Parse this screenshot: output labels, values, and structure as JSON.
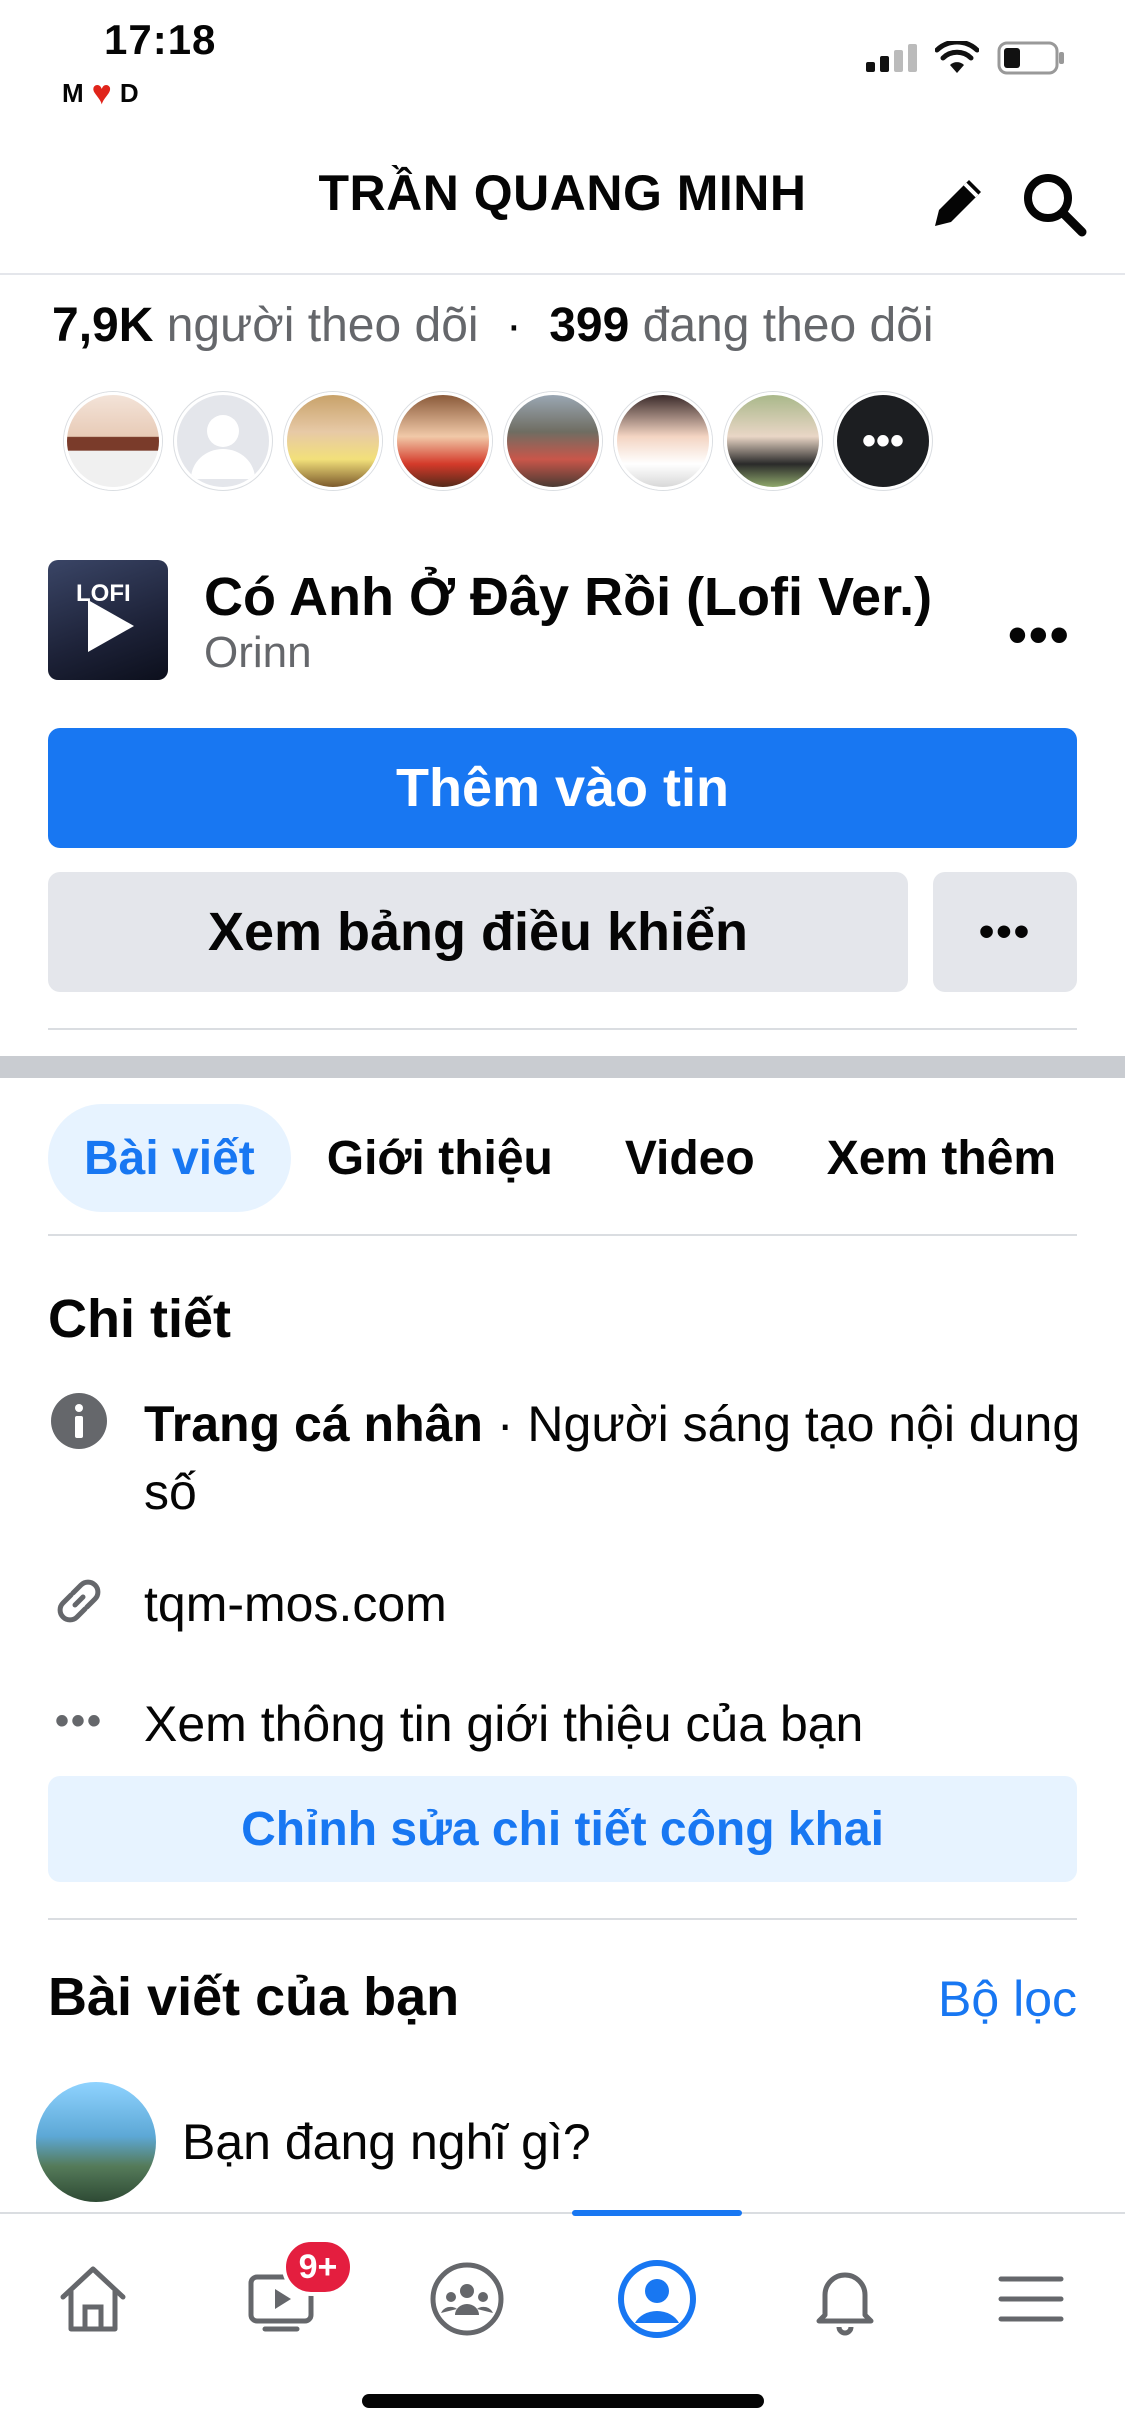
{
  "status_bar": {
    "time": "17:18",
    "carrier_left": "M",
    "carrier_right": "D"
  },
  "header": {
    "title": "TRẦN QUANG MINH"
  },
  "followers": {
    "followers_count": "7,9K",
    "followers_label": "người theo dõi",
    "separator": "·",
    "following_count": "399",
    "following_label": "đang theo dõi",
    "more_avatars": "•••"
  },
  "music": {
    "cover_text": "LOFI",
    "title": "Có Anh Ở Đây Rồi (Lofi Ver.)",
    "artist": "Orinn",
    "more": "•••"
  },
  "actions": {
    "add_to_story": "Thêm vào tin",
    "view_dashboard": "Xem bảng điều khiển",
    "more": "•••"
  },
  "tabs": [
    {
      "label": "Bài viết",
      "active": true
    },
    {
      "label": "Giới thiệu",
      "active": false
    },
    {
      "label": "Video",
      "active": false
    },
    {
      "label": "Xem thêm",
      "active": false
    }
  ],
  "details": {
    "title": "Chi tiết",
    "profile_type_bold": "Trang cá nhân",
    "profile_type_rest": " · Người sáng tạo nội dung số",
    "website": "tqm-mos.com",
    "see_about": "Xem thông tin giới thiệu của bạn",
    "edit_public_details": "Chỉnh sửa chi tiết công khai"
  },
  "posts": {
    "title": "Bài viết của bạn",
    "filter": "Bộ lọc",
    "composer_placeholder": "Bạn đang nghĩ gì?"
  },
  "bottom_nav": {
    "items": [
      "home-icon",
      "watch-icon",
      "groups-icon",
      "profile-icon",
      "notifications-icon",
      "menu-icon"
    ],
    "watch_badge": "9+",
    "active": "profile-icon"
  },
  "colors": {
    "accent": "#1877f2",
    "accent_light": "#e7f3ff",
    "badge": "#e41e3f",
    "button_gray": "#e4e6eb"
  }
}
